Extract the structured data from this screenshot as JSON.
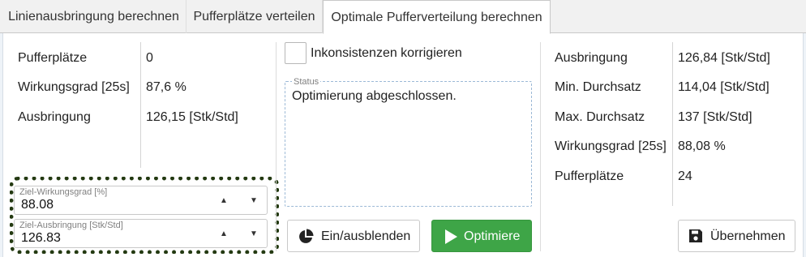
{
  "tabs": [
    {
      "label": "Linienausbringung berechnen",
      "active": false
    },
    {
      "label": "Pufferplätze verteilen",
      "active": false
    },
    {
      "label": "Optimale Pufferverteilung berechnen",
      "active": true
    }
  ],
  "left_panel": {
    "rows": [
      {
        "key": "Pufferplätze",
        "value": "0"
      },
      {
        "key": "Wirkungsgrad [25s]",
        "value": "87,6 %"
      },
      {
        "key": "Ausbringung",
        "value": "126,15 [Stk/Std]"
      }
    ],
    "target_efficiency": {
      "label": "Ziel-Wirkungsgrad [%]",
      "value": "88.08"
    },
    "target_output": {
      "label": "Ziel-Ausbringung [Stk/Std]",
      "value": "126.83"
    }
  },
  "middle_panel": {
    "fix_inconsistencies_label": "Inkonsistenzen korrigieren",
    "fix_inconsistencies_checked": false,
    "status_label": "Status",
    "status_text": "Optimierung abgeschlossen.",
    "toggle_button_label": "Ein/ausblenden",
    "optimize_button_label": "Optimiere"
  },
  "right_panel": {
    "rows": [
      {
        "key": "Ausbringung",
        "value": "126,84 [Stk/Std]"
      },
      {
        "key": "Min. Durchsatz",
        "value": "114,04 [Stk/Std]"
      },
      {
        "key": "Max. Durchsatz",
        "value": "137 [Stk/Std]"
      },
      {
        "key": "Wirkungsgrad [25s]",
        "value": "88,08 %"
      },
      {
        "key": "Pufferplätze",
        "value": "24"
      }
    ],
    "apply_button_label": "Übernehmen"
  },
  "icons": {
    "toggle": "pie-chart-icon",
    "optimize": "play-icon",
    "apply": "save-icon",
    "spin_up": "triangle-up-icon",
    "spin_down": "triangle-down-icon"
  },
  "colors": {
    "optimize_button": "#3ea547",
    "focus_ring": "#243a12",
    "status_border": "#9cb9d6"
  }
}
